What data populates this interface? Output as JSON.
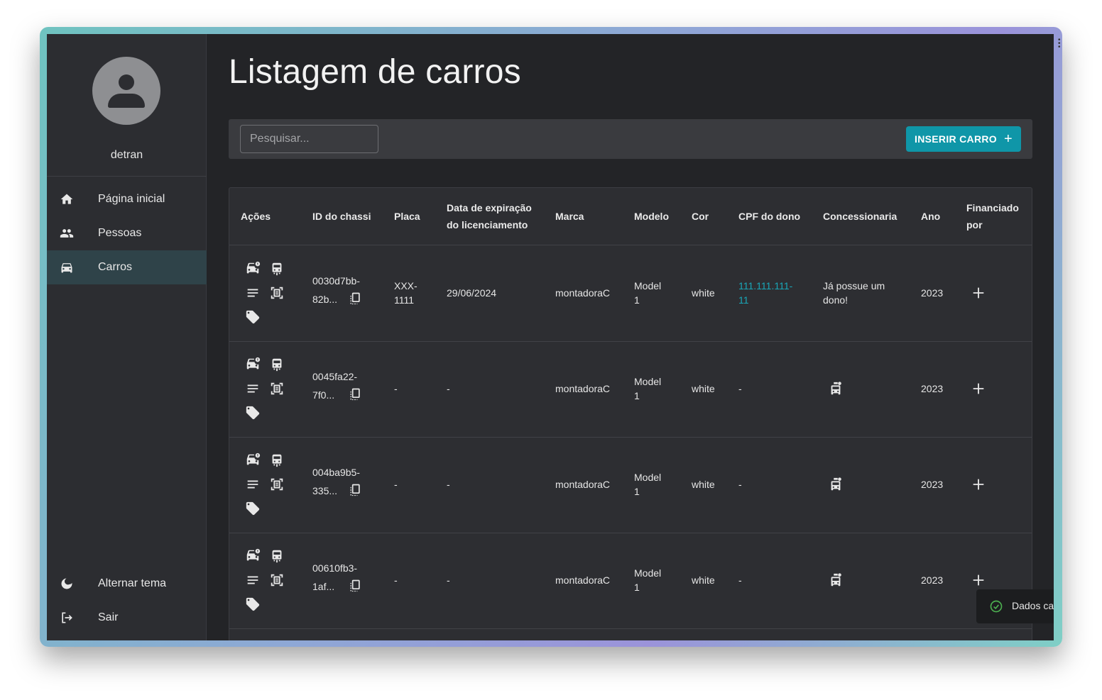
{
  "user": {
    "name": "detran"
  },
  "nav": {
    "items": [
      {
        "label": "Página inicial",
        "icon": "home-icon"
      },
      {
        "label": "Pessoas",
        "icon": "people-icon"
      },
      {
        "label": "Carros",
        "icon": "car-icon",
        "active": true
      }
    ],
    "bottom": [
      {
        "label": "Alternar tema",
        "icon": "moon-icon"
      },
      {
        "label": "Sair",
        "icon": "logout-icon"
      }
    ]
  },
  "page": {
    "title": "Listagem de carros"
  },
  "toolbar": {
    "search_placeholder": "Pesquisar...",
    "insert_label": "INSERIR CARRO"
  },
  "table": {
    "headers": {
      "acoes": "Ações",
      "chassi": "ID do chassi",
      "placa": "Placa",
      "expiracao_1": "Data de expiração",
      "expiracao_2": "do licenciamento",
      "marca": "Marca",
      "modelo": "Modelo",
      "cor": "Cor",
      "cpf": "CPF do dono",
      "concessionaria": "Concessionaria",
      "ano": "Ano",
      "financiado_1": "Financiado",
      "financiado_2": "por"
    },
    "rows": [
      {
        "chassi_1": "0030d7bb-",
        "chassi_2": "82b...",
        "placa_1": "XXX-",
        "placa_2": "1111",
        "expiracao": "29/06/2024",
        "marca": "montadoraC",
        "modelo_1": "Model",
        "modelo_2": "1",
        "cor": "white",
        "cpf_1": "111.111.111-",
        "cpf_2": "11",
        "concessionaria_1": "Já possue um",
        "concessionaria_2": "dono!",
        "ano": "2023"
      },
      {
        "chassi_1": "0045fa22-",
        "chassi_2": "7f0...",
        "placa_1": "-",
        "placa_2": "",
        "expiracao": "-",
        "marca": "montadoraC",
        "modelo_1": "Model",
        "modelo_2": "1",
        "cor": "white",
        "cpf_1": "-",
        "cpf_2": "",
        "concessionaria_1": "",
        "concessionaria_2": "",
        "ano": "2023"
      },
      {
        "chassi_1": "004ba9b5-",
        "chassi_2": "335...",
        "placa_1": "-",
        "placa_2": "",
        "expiracao": "-",
        "marca": "montadoraC",
        "modelo_1": "Model",
        "modelo_2": "1",
        "cor": "white",
        "cpf_1": "-",
        "cpf_2": "",
        "concessionaria_1": "",
        "concessionaria_2": "",
        "ano": "2023"
      },
      {
        "chassi_1": "00610fb3-",
        "chassi_2": "1af...",
        "placa_1": "-",
        "placa_2": "",
        "expiracao": "-",
        "marca": "montadoraC",
        "modelo_1": "Model",
        "modelo_2": "1",
        "cor": "white",
        "cpf_1": "-",
        "cpf_2": "",
        "concessionaria_1": "",
        "concessionaria_2": "",
        "ano": "2023"
      }
    ]
  },
  "toast": {
    "message": "Dados carregados com sucesso!"
  },
  "colors": {
    "accent": "#0f96a8",
    "link": "#19a7b8",
    "success": "#4caf50",
    "background": "#232427",
    "sidebar": "#2c2d31"
  }
}
